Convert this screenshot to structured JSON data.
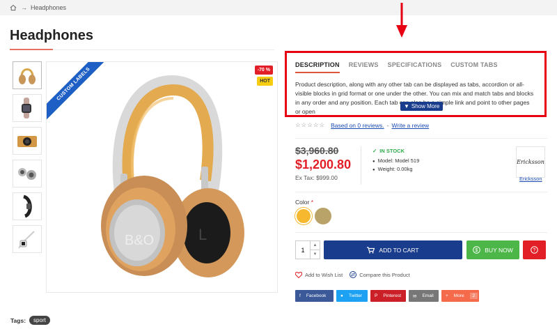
{
  "breadcrumb": {
    "home_icon": "home-icon",
    "current": "Headphones"
  },
  "page_title": "Headphones",
  "product": {
    "ribbon": "CUSTOM LABELS",
    "badge_sale": "-70 %",
    "badge_hot": "HOT",
    "thumbnails": [
      "headphones-gold",
      "watch-rose",
      "camera-gold",
      "speakers-gray",
      "band-black",
      "earphones-white"
    ]
  },
  "tabs": {
    "items": [
      "DESCRIPTION",
      "REVIEWS",
      "SPECIFICATIONS",
      "CUSTOM TABS"
    ],
    "active": 0,
    "description": "Product description, along with any other tab can be displayed as tabs, accordion or all-visible blocks in grid format or one under the other.  You can mix and match tabs and blocks in any order and any position. Each tab can also be a simple link and point to other pages or open",
    "show_more": "Show More"
  },
  "rating": {
    "stars": "☆☆☆☆☆",
    "reviews_link": "Based on 0 reviews.",
    "separator": "-",
    "write_review": "Write a review"
  },
  "price": {
    "old": "$3,960.80",
    "new": "$1,200.80",
    "ex_tax": "Ex Tax: $999.00"
  },
  "stock": {
    "status": "IN STOCK",
    "model": "Model: Model 519",
    "weight": "Weight: 0.00kg"
  },
  "brand": {
    "logo_text": "Ericksson",
    "link": "Ericksson"
  },
  "options": {
    "color_label": "Color",
    "required_mark": "*",
    "swatches": [
      {
        "name": "gold",
        "color": "#f5b82e"
      },
      {
        "name": "khaki",
        "color": "#b9a368"
      }
    ]
  },
  "cart": {
    "qty": "1",
    "add_to_cart": "ADD TO CART",
    "buy_now": "BUY NOW",
    "question_icon": "question-icon"
  },
  "actions": {
    "wishlist": "Add to Wish List",
    "compare": "Compare this Product"
  },
  "share": [
    {
      "label": "Facebook",
      "color": "#3b5998"
    },
    {
      "label": "Twitter",
      "color": "#1da1f2"
    },
    {
      "label": "Pinterest",
      "color": "#cb2027"
    },
    {
      "label": "Email",
      "color": "#777777"
    },
    {
      "label": "More",
      "count": "2",
      "color": "#f46a4b"
    }
  ],
  "tags": {
    "label": "Tags:",
    "items": [
      "sport"
    ]
  },
  "colors": {
    "accent": "#e0533d",
    "primary": "#1a3c8c",
    "sale": "#e21f26",
    "success": "#4cb648"
  }
}
